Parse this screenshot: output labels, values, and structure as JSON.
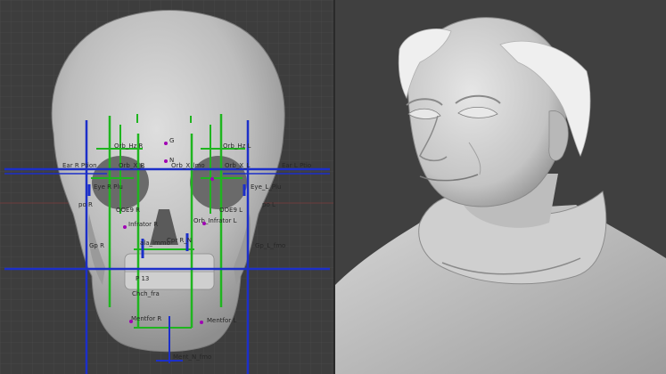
{
  "viewport_left": {
    "name": "skull-viewport",
    "landmark_labels": [
      "Orb_Hz R",
      "G",
      "Orb_Hz L",
      "Orb_X_R",
      "N",
      "Orb_X_lmo",
      "Orb_X_L",
      "Ear R Ption",
      "Ear L Ptio",
      "Eye R Plu",
      "Eye_L_Plu",
      "po R",
      "po L",
      "OOE9 R",
      "OOE9 L",
      "Infrator R",
      "Orb_Infrator L",
      "ala_lmmo",
      "Cpr R_N",
      "Gp R",
      "Gp_L_fmo",
      "Chch_fra",
      "Mentfor R",
      "Mentfor L",
      "Ment_N_fmo",
      "P 13"
    ],
    "colors": {
      "grid_bg": "#3d3d3d",
      "green": "#1fb51f",
      "blue": "#1c2fc9",
      "purple": "#a000b4"
    }
  },
  "viewport_right": {
    "name": "bust-viewport",
    "colors": {
      "bg": "#404040",
      "sculpt": "#c8c8c8"
    }
  }
}
